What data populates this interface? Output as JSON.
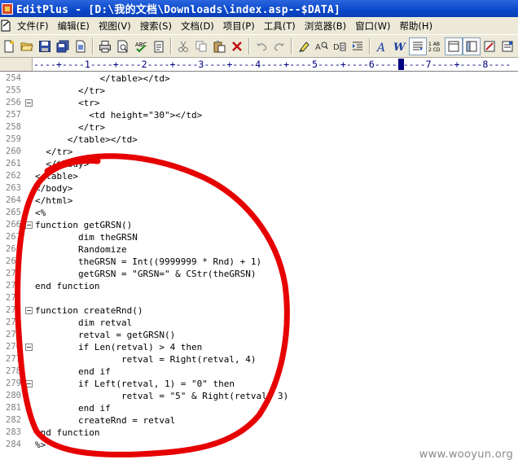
{
  "window": {
    "title": "EditPlus - [D:\\我的文档\\Downloads\\index.asp--$DATA]"
  },
  "menu": {
    "items": [
      "文件(F)",
      "编辑(E)",
      "视图(V)",
      "搜索(S)",
      "文档(D)",
      "项目(P)",
      "工具(T)",
      "浏览器(B)",
      "窗口(W)",
      "帮助(H)"
    ]
  },
  "toolbar": {
    "buttons": [
      "new-file-icon",
      "open-folder-icon",
      "save-icon",
      "save-all-icon",
      "close-file-icon",
      "print-icon",
      "print-preview-icon",
      "spell-check-icon",
      "clipboard-history-icon",
      "cut-icon",
      "copy-icon",
      "paste-icon",
      "delete-icon",
      "undo-icon",
      "redo-icon",
      "highlighter-icon",
      "find-text-icon",
      "find-in-files-icon",
      "indent-icon",
      "font-icon",
      "word-wrap-icon",
      "paragraph-icon",
      "line-number-icon",
      "ruler-icon",
      "browser-icon",
      "cliptext-icon",
      "directory-icon"
    ]
  },
  "ruler": {
    "text": "----+----1----+----2----+----3----+----4----+----5----+----6---- ----7----+----8----"
  },
  "editor": {
    "lines": [
      {
        "n": "254",
        "fold": false,
        "text": "            </table></td>"
      },
      {
        "n": "255",
        "fold": false,
        "text": "        </tr>"
      },
      {
        "n": "256",
        "fold": true,
        "text": "        <tr>"
      },
      {
        "n": "257",
        "fold": false,
        "text": "          <td height=\"30\"></td>"
      },
      {
        "n": "258",
        "fold": false,
        "text": "        </tr>"
      },
      {
        "n": "259",
        "fold": false,
        "text": "      </table></td>"
      },
      {
        "n": "260",
        "fold": false,
        "text": "  </tr>"
      },
      {
        "n": "261",
        "fold": false,
        "text": "  </tbody>"
      },
      {
        "n": "262",
        "fold": false,
        "text": "</table>"
      },
      {
        "n": "263",
        "fold": false,
        "text": "</body>"
      },
      {
        "n": "264",
        "fold": false,
        "text": "</html>"
      },
      {
        "n": "265",
        "fold": false,
        "text": "<%"
      },
      {
        "n": "266",
        "fold": true,
        "text": "function getGRSN()"
      },
      {
        "n": "267",
        "fold": false,
        "text": "        dim theGRSN"
      },
      {
        "n": "268",
        "fold": false,
        "text": "        Randomize"
      },
      {
        "n": "269",
        "fold": false,
        "text": "        theGRSN = Int((9999999 * Rnd) + 1)"
      },
      {
        "n": "270",
        "fold": false,
        "text": "        getGRSN = \"GRSN=\" & CStr(theGRSN)"
      },
      {
        "n": "271",
        "fold": false,
        "text": "end function"
      },
      {
        "n": "272",
        "fold": false,
        "text": ""
      },
      {
        "n": "273",
        "fold": true,
        "text": "function createRnd()"
      },
      {
        "n": "274",
        "fold": false,
        "text": "        dim retval"
      },
      {
        "n": "275",
        "fold": false,
        "text": "        retval = getGRSN()"
      },
      {
        "n": "276",
        "fold": true,
        "text": "        if Len(retval) > 4 then"
      },
      {
        "n": "277",
        "fold": false,
        "text": "                retval = Right(retval, 4)"
      },
      {
        "n": "278",
        "fold": false,
        "text": "        end if"
      },
      {
        "n": "279",
        "fold": true,
        "text": "        if Left(retval, 1) = \"0\" then"
      },
      {
        "n": "280",
        "fold": false,
        "text": "                retval = \"5\" & Right(retval, 3)"
      },
      {
        "n": "281",
        "fold": false,
        "text": "        end if"
      },
      {
        "n": "282",
        "fold": false,
        "text": "        createRnd = retval"
      },
      {
        "n": "283",
        "fold": false,
        "text": "end function"
      },
      {
        "n": "284",
        "fold": false,
        "text": "%>"
      }
    ]
  },
  "watermark": "www.wooyun.org",
  "colors": {
    "titlebar": "#0a47c8",
    "chrome": "#ece9d8",
    "annotation": "#e60000",
    "line_numbers": "#808080"
  }
}
